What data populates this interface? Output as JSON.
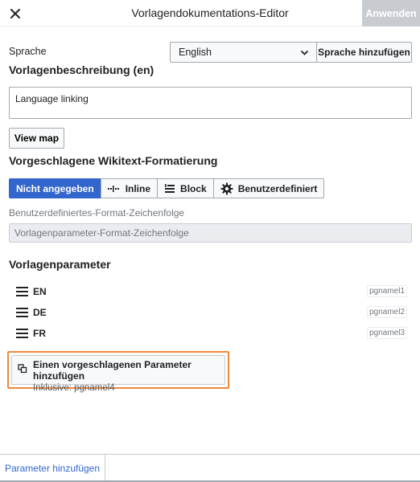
{
  "header": {
    "title": "Vorlagendokumentations-Editor",
    "apply_label": "Anwenden",
    "close_icon": "close-icon"
  },
  "language": {
    "label": "Sprache",
    "selected": "English",
    "add_label": "Sprache hinzufügen"
  },
  "description": {
    "heading": "Vorlagenbeschreibung (en)",
    "value": "Language linking"
  },
  "view_map_label": "View map",
  "format": {
    "heading": "Vorgeschlagene Wikitext-Formatierung",
    "options": [
      {
        "label": "Nicht angegeben",
        "icon": "",
        "active": true
      },
      {
        "label": "Inline",
        "icon": "inline-icon",
        "active": false
      },
      {
        "label": "Block",
        "icon": "block-icon",
        "active": false
      },
      {
        "label": "Benutzerdefiniert",
        "icon": "gear-icon",
        "active": false
      }
    ],
    "custom_label": "Benutzerdefiniertes-Format-Zeichenfolge",
    "custom_placeholder": "Vorlagenparameter-Format-Zeichenfolge"
  },
  "params": {
    "heading": "Vorlagenparameter",
    "items": [
      {
        "name": "EN",
        "key": "pgnamel1"
      },
      {
        "name": "DE",
        "key": "pgnamel2"
      },
      {
        "name": "FR",
        "key": "pgnamel3"
      }
    ],
    "suggest_title": "Einen vorgeschlagenen Parameter hinzufügen",
    "suggest_sub": "Inklusive: pgnamel4"
  },
  "footer": {
    "add_param_label": "Parameter hinzufügen"
  },
  "colors": {
    "accent": "#3366cc",
    "highlight": "#f0883c",
    "disabled": "#c8ccd1"
  }
}
